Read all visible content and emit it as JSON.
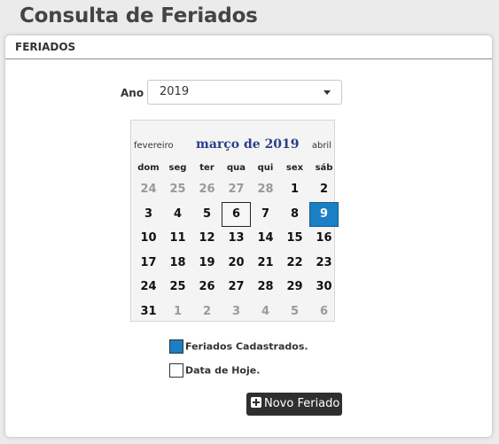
{
  "page": {
    "title": "Consulta de Feriados"
  },
  "panel": {
    "title": "FERIADOS"
  },
  "year": {
    "label": "Ano",
    "selected": "2019"
  },
  "calendar": {
    "prev_month": "fevereiro",
    "current_month": "março de 2019",
    "next_month": "abril",
    "weekdays": [
      "dom",
      "seg",
      "ter",
      "qua",
      "qui",
      "sex",
      "sáb"
    ],
    "weeks": [
      [
        {
          "d": "24",
          "other": true
        },
        {
          "d": "25",
          "other": true
        },
        {
          "d": "26",
          "other": true
        },
        {
          "d": "27",
          "other": true
        },
        {
          "d": "28",
          "other": true
        },
        {
          "d": "1"
        },
        {
          "d": "2"
        }
      ],
      [
        {
          "d": "3"
        },
        {
          "d": "4"
        },
        {
          "d": "5"
        },
        {
          "d": "6",
          "today": true
        },
        {
          "d": "7"
        },
        {
          "d": "8"
        },
        {
          "d": "9",
          "holiday": true
        }
      ],
      [
        {
          "d": "10"
        },
        {
          "d": "11"
        },
        {
          "d": "12"
        },
        {
          "d": "13"
        },
        {
          "d": "14"
        },
        {
          "d": "15"
        },
        {
          "d": "16"
        }
      ],
      [
        {
          "d": "17"
        },
        {
          "d": "18"
        },
        {
          "d": "19"
        },
        {
          "d": "20"
        },
        {
          "d": "21"
        },
        {
          "d": "22"
        },
        {
          "d": "23"
        }
      ],
      [
        {
          "d": "24"
        },
        {
          "d": "25"
        },
        {
          "d": "26"
        },
        {
          "d": "27"
        },
        {
          "d": "28"
        },
        {
          "d": "29"
        },
        {
          "d": "30"
        }
      ],
      [
        {
          "d": "31"
        },
        {
          "d": "1",
          "other": true
        },
        {
          "d": "2",
          "other": true
        },
        {
          "d": "3",
          "other": true
        },
        {
          "d": "4",
          "other": true
        },
        {
          "d": "5",
          "other": true
        },
        {
          "d": "6",
          "other": true
        }
      ]
    ]
  },
  "legend": {
    "holidays": "Feriados Cadastrados.",
    "today": "Data de Hoje."
  },
  "actions": {
    "new_holiday": "Novo Feriado"
  },
  "colors": {
    "holiday": "#1a7fc4",
    "title_month": "#2a3f88"
  }
}
